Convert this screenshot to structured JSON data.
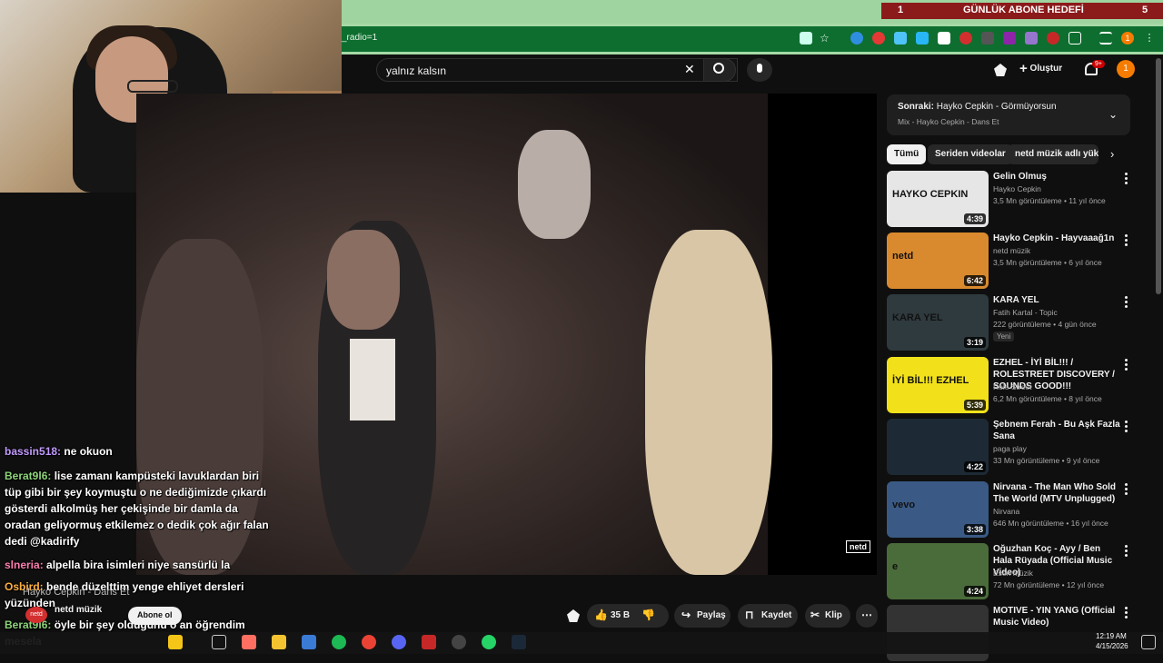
{
  "goal": {
    "left_num": "1",
    "label": "GÜNLÜK ABONE HEDEFİ",
    "right_num": "5"
  },
  "browser": {
    "url_fragment": "_radio=1",
    "profile_initial": "1"
  },
  "search": {
    "query": "yalnız kalsın"
  },
  "header": {
    "create_label": "Oluştur",
    "notif_count": "9+",
    "avatar_initial": "1"
  },
  "next_up": {
    "title_prefix": "Sonraki:",
    "title": "Hayko Cepkin - Görmüyorsun",
    "subtitle": "Mix - Hayko Cepkin - Dans Et"
  },
  "chips": [
    "Tümü",
    "Seriden videolar",
    "netd müzik adlı yükle"
  ],
  "recommendations": [
    {
      "title": "Gelin Olmuş",
      "channel": "Hayko Cepkin",
      "meta": "3,5 Mn görüntüleme • 11 yıl önce",
      "duration": "4:39",
      "thumb_text": "HAYKO CEPKIN",
      "thumb_color": "#e6e6e6",
      "badge": ""
    },
    {
      "title": "Hayko Cepkin - Hayvaaağ1n",
      "channel": "netd müzik",
      "meta": "3,5 Mn görüntüleme • 6 yıl önce",
      "duration": "6:42",
      "thumb_text": "netd",
      "thumb_color": "#d98a2e",
      "badge": ""
    },
    {
      "title": "KARA YEL",
      "channel": "Fatih Kartal - Topic",
      "meta": "222 görüntüleme • 4 gün önce",
      "duration": "3:19",
      "thumb_text": "KARA YEL",
      "thumb_color": "#2f3a3e",
      "badge": "Yeni"
    },
    {
      "title": "EZHEL - İYİ BİL!!! / ROLESTREET DISCOVERY / SOUNDS GOOD!!!",
      "channel": "Role Street",
      "meta": "6,2 Mn görüntüleme • 8 yıl önce",
      "duration": "5:39",
      "thumb_text": "İYİ BİL!!! EZHEL",
      "thumb_color": "#f2e11a",
      "badge": ""
    },
    {
      "title": "Şebnem Ferah - Bu Aşk Fazla Sana",
      "channel": "paga play",
      "meta": "33 Mn görüntüleme • 9 yıl önce",
      "duration": "4:22",
      "thumb_text": "",
      "thumb_color": "#1d2a35",
      "badge": ""
    },
    {
      "title": "Nirvana - The Man Who Sold The World (MTV Unplugged)",
      "channel": "Nirvana",
      "meta": "646 Mn görüntüleme • 16 yıl önce",
      "duration": "3:38",
      "thumb_text": "vevo",
      "thumb_color": "#3a5a85",
      "badge": ""
    },
    {
      "title": "Oğuzhan Koç - Ayy / Ben Hala Rüyada (Official Music Video)",
      "channel": "Esen Müzik",
      "meta": "72 Mn görüntüleme • 12 yıl önce",
      "duration": "4:24",
      "thumb_text": "e",
      "thumb_color": "#4a6b3a",
      "badge": ""
    },
    {
      "title": "MOTIVE - YIN YANG (Official Music Video)",
      "channel": "",
      "meta": "",
      "duration": "",
      "thumb_text": "",
      "thumb_color": "#333333",
      "badge": ""
    }
  ],
  "actions": {
    "likes": "35 B",
    "share": "Paylaş",
    "save": "Kaydet",
    "clip": "Klip"
  },
  "channel": {
    "name": "netd müzik",
    "subscribe": "Abone ol",
    "watermark": "netd"
  },
  "chat": [
    {
      "user": "bassin518:",
      "msg": "ne okuon",
      "color": "u-purple"
    },
    {
      "user": "Berat9l6:",
      "msg": "lise zamanı kampüsteki lavuklardan biri tüp gibi bir şey koymuştu o ne dediğimizde çıkardı gösterdi alkolmüş her çekişinde bir damla da oradan geliyormuş etkilemez o dedik çok ağır falan dedi @kadirify",
      "color": "u-green"
    },
    {
      "user": "slneria:",
      "msg": "alpella bira isimleri niye sansürlü la",
      "color": "u-pink"
    },
    {
      "user": "Osbird:",
      "msg": "bende düzelttim yenge ehliyet dersleri yüzünden",
      "color": "u-orange"
    },
    {
      "user": "Berat9l6:",
      "msg": "öyle bir şey olduğunu o an öğrendim mesela",
      "color": "u-green"
    }
  ],
  "overlay_text": "Hayko Cepkin - Dans Et",
  "taskbar": {
    "time": "12:19 AM",
    "date": "4/15/2026"
  }
}
